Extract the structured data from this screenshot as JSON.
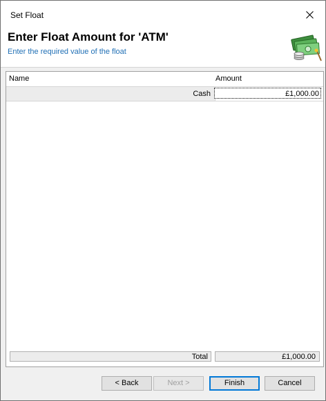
{
  "window": {
    "title": "Set Float"
  },
  "header": {
    "title": "Enter Float Amount for 'ATM'",
    "subtitle": "Enter the required value of the float",
    "icon": "money-stack-icon"
  },
  "grid": {
    "columns": {
      "name": "Name",
      "amount": "Amount"
    },
    "rows": [
      {
        "name": "Cash",
        "amount": "£1,000.00"
      }
    ],
    "total": {
      "label": "Total",
      "value": "£1,000.00"
    }
  },
  "buttons": {
    "back": "< Back",
    "next": "Next >",
    "finish": "Finish",
    "cancel": "Cancel"
  },
  "colors": {
    "subtitle": "#1f6fb5",
    "default_button_border": "#0078d7"
  }
}
